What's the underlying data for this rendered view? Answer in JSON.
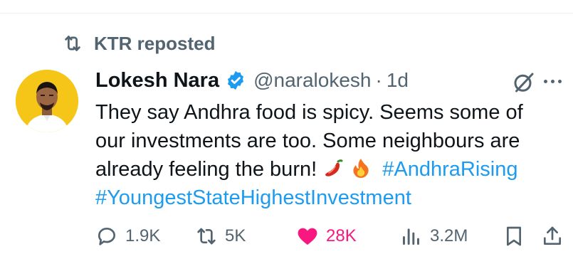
{
  "repost": {
    "label": "KTR reposted",
    "icon": "repost-icon"
  },
  "author": {
    "display_name": "Lokesh Nara",
    "handle": "@naralokesh",
    "separator": "·",
    "time": "1d",
    "verified": true,
    "verified_color": "#1d9bf0"
  },
  "tweet": {
    "line1": "They say Andhra food is spicy. Seems some of",
    "line2": "our investments are too. Some neighbours are",
    "line3_text": "already feeling the burn!",
    "line3_hashtag": "#AndhraRising",
    "line4_hashtag": "#YoungestStateHighestInvestment",
    "emojis": [
      "chili-pepper",
      "fire"
    ]
  },
  "actions": {
    "replies": "1.9K",
    "reposts": "5K",
    "likes": "28K",
    "views": "3.2M"
  },
  "colors": {
    "text": "#0f1419",
    "secondary": "#536471",
    "link": "#1d9bf0",
    "like": "#f91880",
    "avatar_bg": "#f5c518"
  }
}
